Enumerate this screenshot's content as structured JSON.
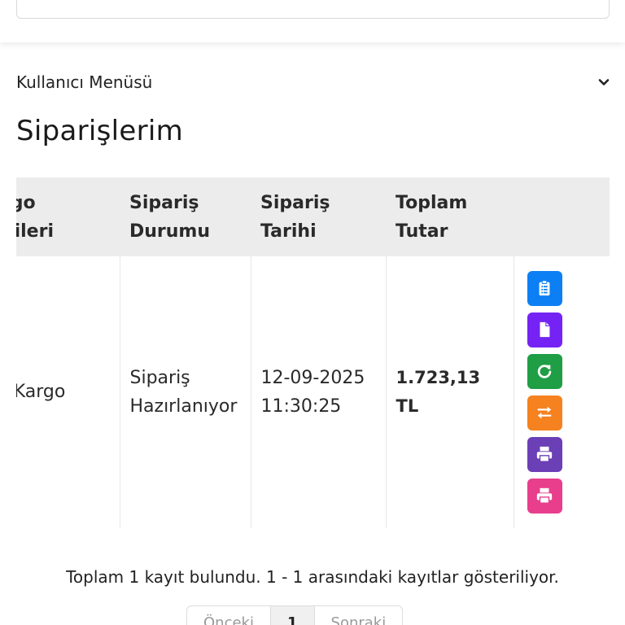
{
  "user_menu": {
    "label": "Kullanıcı Menüsü"
  },
  "page": {
    "title": "Siparişlerim"
  },
  "table": {
    "headers": [
      {
        "line1": "Kargo",
        "line2": "Bilgileri"
      },
      {
        "line1": "Sipariş",
        "line2": "Durumu"
      },
      {
        "line1": "Sipariş",
        "line2": "Tarihi"
      },
      {
        "line1": "Toplam",
        "line2": "Tutar"
      },
      {
        "line1": "",
        "line2": ""
      }
    ],
    "rows": [
      {
        "cargo": "PTT Kargo",
        "status_line1": "Sipariş",
        "status_line2": "Hazırlanıyor",
        "date": "12-09-2025",
        "time": "11:30:25",
        "total": "1.723,13 TL"
      }
    ]
  },
  "actions": [
    {
      "icon": "clipboard-list-icon",
      "color": "#0d7ff5"
    },
    {
      "icon": "document-icon",
      "color": "#7423f4"
    },
    {
      "icon": "refresh-icon",
      "color": "#1f9e45"
    },
    {
      "icon": "exchange-icon",
      "color": "#f5821f"
    },
    {
      "icon": "print-icon",
      "color": "#6b3fb6"
    },
    {
      "icon": "print-icon",
      "color": "#e83e8c"
    }
  ],
  "summary": {
    "text": "Toplam 1 kayıt bulundu. 1 - 1 arasındaki kayıtlar gösteriliyor."
  },
  "pagination": {
    "prev": "Önceki",
    "current": "1",
    "next": "Sonraki"
  }
}
